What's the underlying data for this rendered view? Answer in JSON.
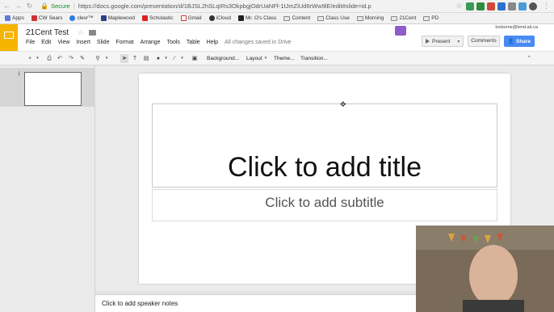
{
  "browser": {
    "secure_label": "Secure",
    "url": "https://docs.google.com/presentation/d/1BJSL2hSLqIRs3OkpbgjOdrUaNFf-1tJmZiUd6rWw9lE/edit#slide=id.p",
    "bookmarks": [
      "Apps",
      "CW Sears",
      "clevr™",
      "Maplewood",
      "Scholastic",
      "Gmail",
      "iCloud",
      "Mr. O's Class",
      "Content",
      "Class Use",
      "Morning",
      "21Cent",
      "PD"
    ]
  },
  "header": {
    "doc_title": "21Cent Test",
    "menu": [
      "File",
      "Edit",
      "View",
      "Insert",
      "Slide",
      "Format",
      "Arrange",
      "Tools",
      "Table",
      "Help"
    ],
    "saved_status": "All changes saved in Drive",
    "user_email": "tosborne@bmd.ab.ca",
    "present_label": "Present",
    "comments_label": "Comments",
    "share_label": "Share"
  },
  "toolbar": {
    "background_label": "Background...",
    "layout_label": "Layout",
    "theme_label": "Theme...",
    "transition_label": "Transition..."
  },
  "filmstrip": {
    "slide_number": "1"
  },
  "slide": {
    "title_placeholder": "Click to add title",
    "subtitle_placeholder": "Click to add subtitle"
  },
  "notes": {
    "placeholder": "Click to add speaker notes"
  },
  "colors": {
    "slides_brand": "#f4b400",
    "share_button": "#4a8af4",
    "secure_green": "#1a8a2a"
  }
}
